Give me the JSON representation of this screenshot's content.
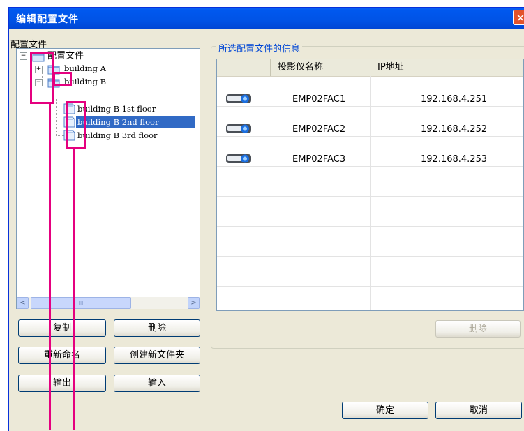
{
  "window": {
    "title": "编辑配置文件",
    "close_glyph": "✕"
  },
  "left": {
    "section_label": "配置文件",
    "tree": [
      {
        "label": "配置文件",
        "expander": "−"
      },
      {
        "label": "building A",
        "expander": "+"
      },
      {
        "label": "building B",
        "expander": "−"
      },
      {
        "label": "building B 1st floor"
      },
      {
        "label": "building B 2nd floor",
        "selected": true
      },
      {
        "label": "building B 3rd floor"
      }
    ],
    "scroll_left": "<",
    "scroll_thumb": "III",
    "scroll_right": ">",
    "buttons": {
      "copy": "复制",
      "delete": "删除",
      "rename": "重新命名",
      "new_folder": "创建新文件夹",
      "export": "输出",
      "import": "输入"
    }
  },
  "right": {
    "group_title": "所选配置文件的信息",
    "columns": [
      "",
      "投影仪名称",
      "IP地址"
    ],
    "rows": [
      {
        "icon": "projector-icon",
        "name": "EMP02FAC1",
        "ip": "192.168.4.251"
      },
      {
        "icon": "projector-icon",
        "name": "EMP02FAC2",
        "ip": "192.168.4.252"
      },
      {
        "icon": "projector-icon",
        "name": "EMP02FAC3",
        "ip": "192.168.4.253"
      }
    ],
    "delete_button": "删除"
  },
  "footer": {
    "ok": "确定",
    "cancel": "取消"
  },
  "colors": {
    "title_bar": "#0054e3",
    "selection": "#316ac5",
    "annotation": "#e5007f",
    "group_title": "#0046d5"
  }
}
